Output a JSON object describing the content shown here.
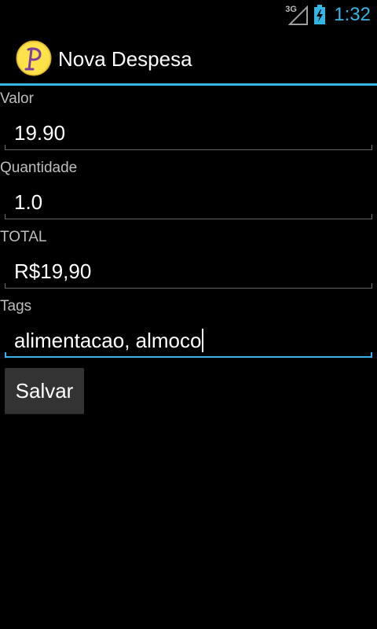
{
  "status_bar": {
    "network_type": "3G",
    "time": "1:32",
    "accent_color": "#33b5e5"
  },
  "action_bar": {
    "app_icon": "p-logo-icon",
    "title": "Nova Despesa",
    "divider_color": "#33b5e5"
  },
  "form": {
    "valor": {
      "label": "Valor",
      "value": "19.90"
    },
    "quantidade": {
      "label": "Quantidade",
      "value": "1.0"
    },
    "total": {
      "label": "TOTAL",
      "value": "R$19,90"
    },
    "tags": {
      "label": "Tags",
      "value": "alimentacao, almoco"
    }
  },
  "buttons": {
    "save_label": "Salvar"
  }
}
